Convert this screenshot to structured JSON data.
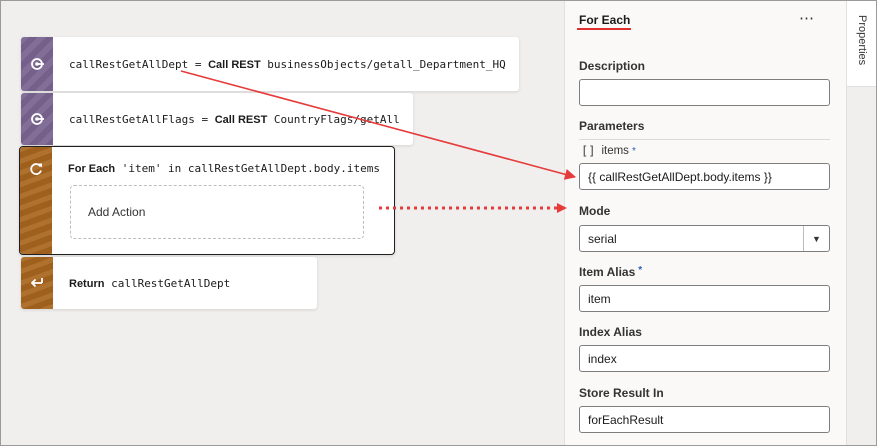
{
  "canvas": {
    "actions": [
      {
        "icon": "rest-call-icon",
        "var": "callRestGetAllDept",
        "eq": " = ",
        "kw": "Call REST",
        "target": " businessObjects/getall_Department_HQ"
      },
      {
        "icon": "rest-call-icon",
        "var": "callRestGetAllFlags",
        "eq": " = ",
        "kw": "Call REST",
        "target": " CountryFlags/getAll"
      }
    ],
    "for_each": {
      "kw": "For Each",
      "text": " 'item' in callRestGetAllDept.body.items",
      "add_action": "Add Action"
    },
    "return_action": {
      "kw": "Return",
      "text": " callRestGetAllDept"
    }
  },
  "panel": {
    "title": "For Each",
    "more": "⋯",
    "description_label": "Description",
    "description_value": "",
    "parameters_label": "Parameters",
    "param_bracket": "[]",
    "param_name": "items",
    "param_required": "*",
    "items_value": "{{ callRestGetAllDept.body.items }}",
    "mode_label": "Mode",
    "mode_value": "serial",
    "item_alias_label": "Item Alias",
    "item_alias_required": "*",
    "item_alias_value": "item",
    "index_alias_label": "Index Alias",
    "index_alias_value": "index",
    "store_result_label": "Store Result In",
    "store_result_value": "forEachResult"
  },
  "tabs": {
    "properties": "Properties"
  },
  "colors": {
    "accent_red": "#e53b3b",
    "rest_purple": "#7a6591",
    "control_brown": "#a8661e"
  }
}
